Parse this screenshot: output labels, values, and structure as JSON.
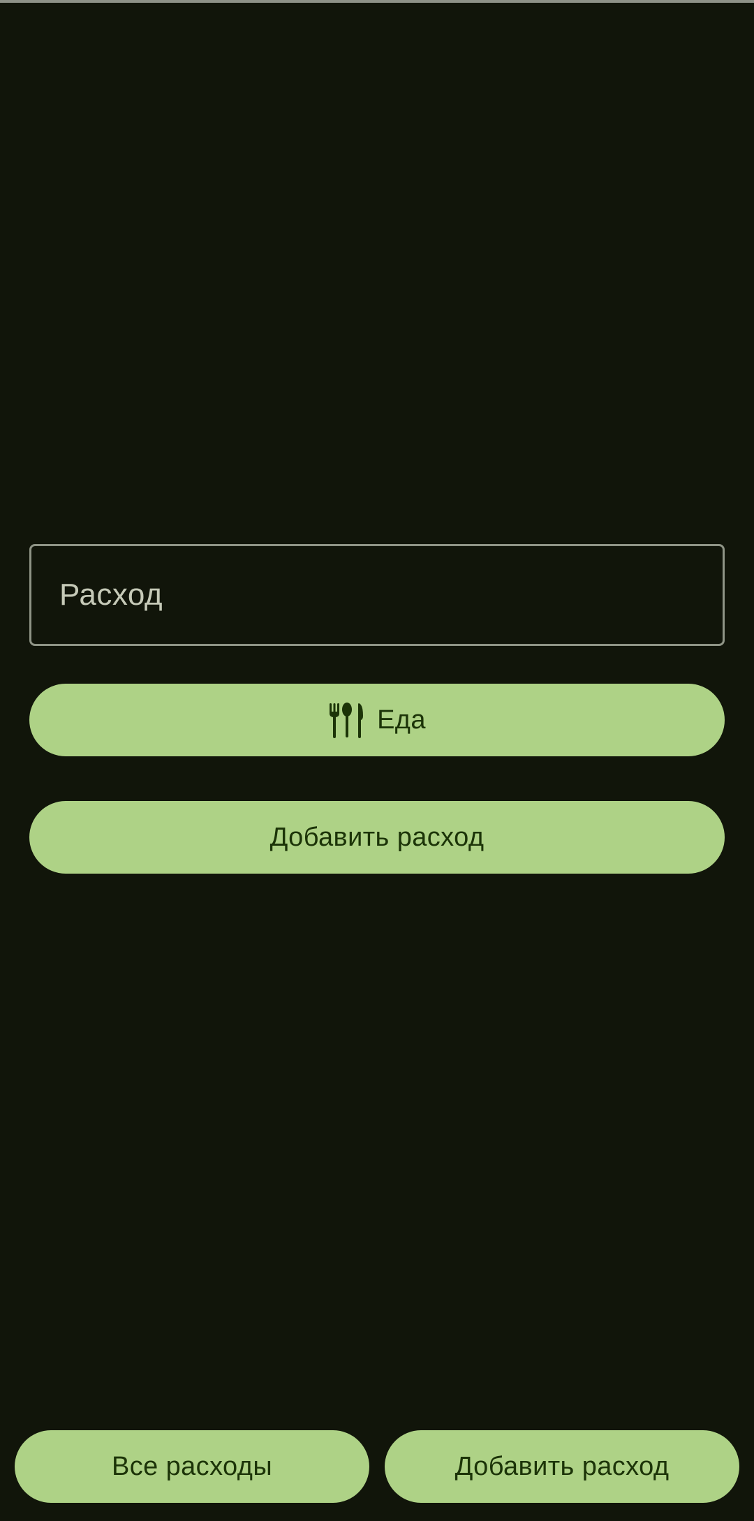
{
  "expense_field": {
    "placeholder": "Расход",
    "value": ""
  },
  "category_button": {
    "label": "Еда",
    "icon": "restaurant-icon"
  },
  "add_expense_button": {
    "label": "Добавить расход"
  },
  "bottom_bar": {
    "all_expenses_label": "Все расходы",
    "add_expense_label": "Добавить расход"
  },
  "colors": {
    "background": "#11150a",
    "button": "#aed286",
    "button_text": "#1c3408",
    "outline": "#8f9486",
    "placeholder": "#c6cab8"
  }
}
